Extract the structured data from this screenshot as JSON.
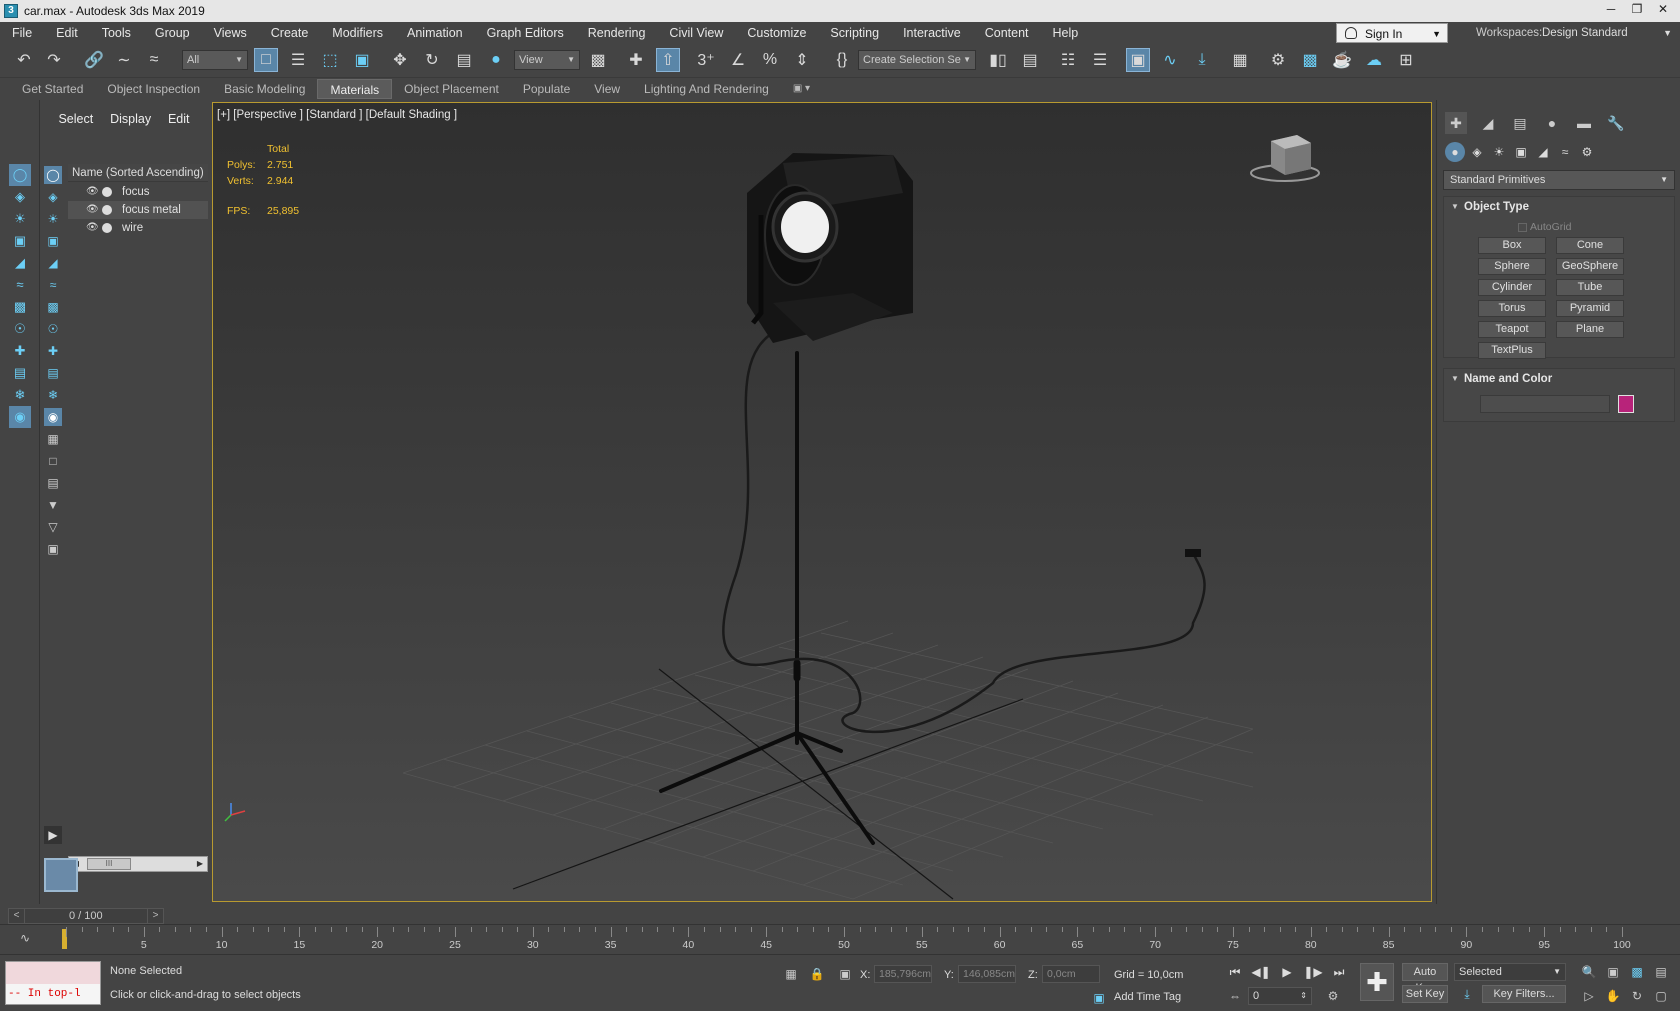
{
  "window": {
    "title": "car.max - Autodesk 3ds Max 2019",
    "app_icon": "3ds-max-icon",
    "controls": [
      "minimize-icon",
      "restore-icon",
      "close-icon"
    ]
  },
  "menu": [
    "File",
    "Edit",
    "Tools",
    "Group",
    "Views",
    "Create",
    "Modifiers",
    "Animation",
    "Graph Editors",
    "Rendering",
    "Civil View",
    "Customize",
    "Scripting",
    "Interactive",
    "Content",
    "Help"
  ],
  "account": {
    "sign_in": "Sign In",
    "workspaces_label": "Workspaces:",
    "workspace_value": "Design Standard"
  },
  "toolbar": {
    "selection_filter": "All",
    "reference_coord": "View",
    "named_selection": "Create Selection Se"
  },
  "ribbon_tabs": [
    {
      "label": "Get Started",
      "active": false
    },
    {
      "label": "Object Inspection",
      "active": false
    },
    {
      "label": "Basic Modeling",
      "active": false
    },
    {
      "label": "Materials",
      "active": true
    },
    {
      "label": "Object Placement",
      "active": false
    },
    {
      "label": "Populate",
      "active": false
    },
    {
      "label": "View",
      "active": false
    },
    {
      "label": "Lighting And Rendering",
      "active": false
    }
  ],
  "scene_explorer": {
    "tabs": [
      "Select",
      "Display",
      "Edit"
    ],
    "column_header": "Name (Sorted Ascending)",
    "objects": [
      {
        "name": "focus",
        "highlighted": false
      },
      {
        "name": "focus metal",
        "highlighted": true
      },
      {
        "name": "wire",
        "highlighted": false
      }
    ],
    "scroll_thumb": "III"
  },
  "viewport": {
    "label": "[+] [Perspective ] [Standard ] [Default Shading ]",
    "stats": {
      "total_label": "Total",
      "polys_label": "Polys:",
      "polys_value": "2.751",
      "verts_label": "Verts:",
      "verts_value": "2.944",
      "fps_label": "FPS:",
      "fps_value": "25,895"
    },
    "border_color": "#b89a30"
  },
  "command_panel": {
    "category_dropdown": "Standard Primitives",
    "object_type": {
      "title": "Object Type",
      "autogrid": "AutoGrid",
      "buttons": [
        "Box",
        "Cone",
        "Sphere",
        "GeoSphere",
        "Cylinder",
        "Tube",
        "Torus",
        "Pyramid",
        "Teapot",
        "Plane",
        "TextPlus"
      ]
    },
    "name_and_color": {
      "title": "Name and Color",
      "color": "#b8237a"
    }
  },
  "timeline": {
    "frame_display": "0 / 100",
    "ruler_labels": [
      "5",
      "10",
      "15",
      "20",
      "25",
      "30",
      "35",
      "40",
      "45",
      "50",
      "55",
      "60",
      "65",
      "70",
      "75",
      "80",
      "85",
      "90",
      "95",
      "100"
    ]
  },
  "status": {
    "maxscript_text": "-- In top-l",
    "selection": "None Selected",
    "prompt": "Click or click-and-drag to select objects",
    "x_label": "X:",
    "x_value": "185,796cm",
    "y_label": "Y:",
    "y_value": "146,085cm",
    "z_label": "Z:",
    "z_value": "0,0cm",
    "grid": "Grid = 10,0cm",
    "add_time_tag": "Add Time Tag",
    "auto_key": "Auto Key",
    "set_key": "Set Key",
    "key_mode": "Selected",
    "frame_value": "0",
    "key_filters": "Key Filters..."
  }
}
